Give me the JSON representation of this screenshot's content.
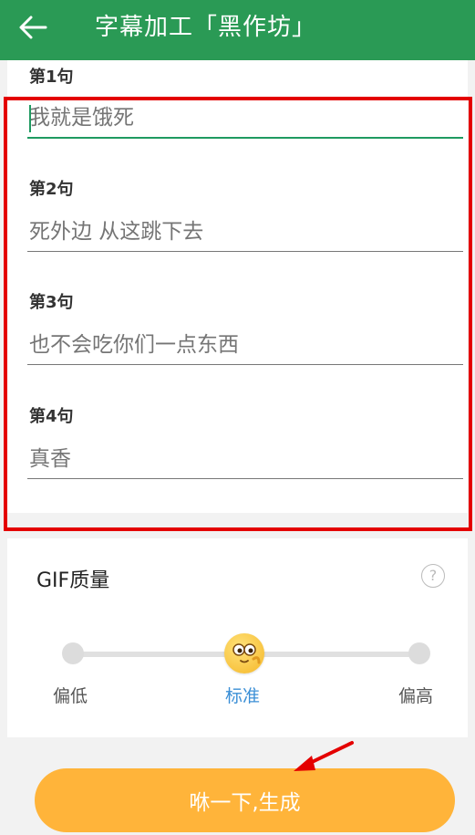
{
  "header": {
    "title": "字幕加工「黑作坊」"
  },
  "sentences": [
    {
      "label": "第1句",
      "placeholder": "我就是饿死"
    },
    {
      "label": "第2句",
      "placeholder": "死外边 从这跳下去"
    },
    {
      "label": "第3句",
      "placeholder": "也不会吃你们一点东西"
    },
    {
      "label": "第4句",
      "placeholder": "真香"
    }
  ],
  "quality": {
    "title": "GIF质量",
    "help": "?",
    "levels": [
      "偏低",
      "标准",
      "偏高"
    ],
    "selected": "标准",
    "selected_fraction": 0.5
  },
  "action": {
    "generate_label": "咻一下,生成"
  },
  "colors": {
    "header_bg": "#2a9a55",
    "accent_green": "#1f9a61",
    "highlight_red": "#e40000",
    "button_orange": "#ffb43a",
    "selected_blue": "#3b8fd6"
  }
}
